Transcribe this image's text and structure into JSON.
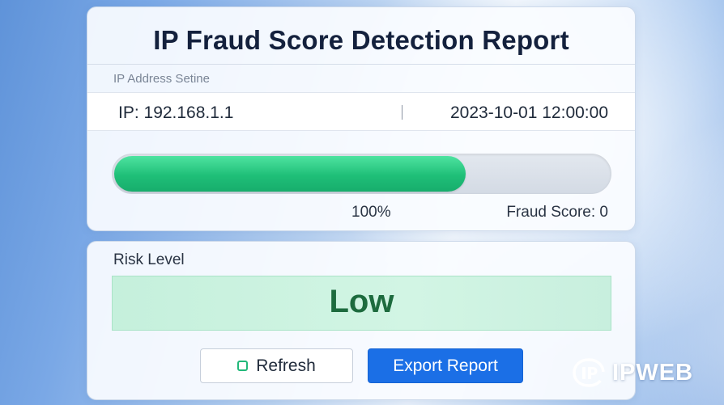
{
  "report": {
    "title": "IP Fraud Score Detection Report",
    "section_label": "IP Address Setine",
    "ip": "IP: 192.168.1.1",
    "timestamp": "2023-10-01 12:00:00"
  },
  "score": {
    "progress_fraction": 0.71,
    "progress_label": "100%",
    "fraud_score_text": "Fraud Score: 0"
  },
  "risk": {
    "label": "Risk Level",
    "value": "Low"
  },
  "actions": {
    "refresh_label": "Refresh",
    "export_label": "Export Report"
  },
  "watermark": {
    "brand": "IPWEB"
  },
  "colors": {
    "progress_green": "#1fbf78",
    "risk_text": "#1d6b3e",
    "export_blue": "#1b6fe6"
  },
  "icons": {
    "refresh": "square-outline-icon",
    "brand": "ipweb-logo-icon"
  }
}
